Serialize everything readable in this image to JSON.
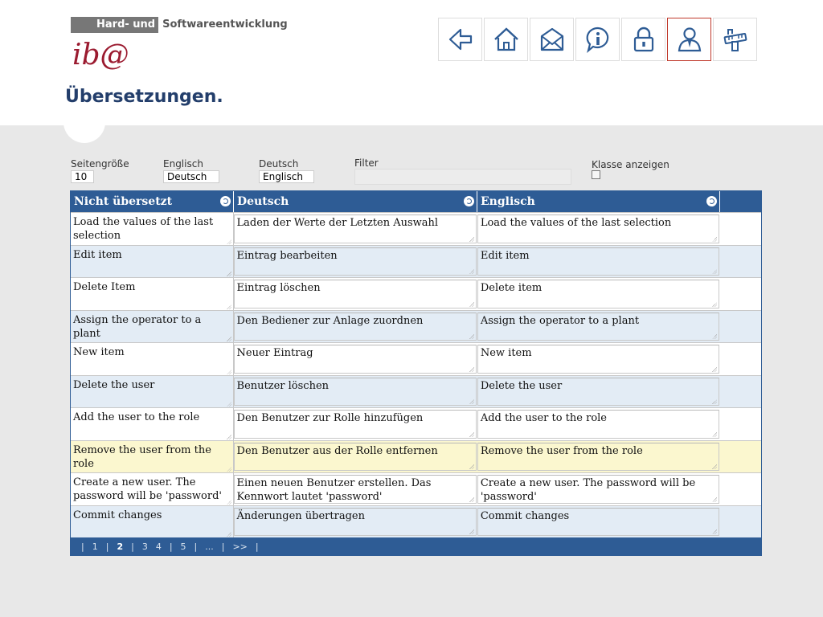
{
  "header": {
    "tag_dark": "Hard- und",
    "tag_light": "Softwareentwicklung",
    "logo_text": "ib@",
    "page_title": "Übersetzungen.",
    "accent_color": "#2e5c95",
    "logo_color": "#9b1b30"
  },
  "nav": [
    {
      "icon": "back-arrow-icon",
      "active": false
    },
    {
      "icon": "home-icon",
      "active": false
    },
    {
      "icon": "envelope-icon",
      "active": false
    },
    {
      "icon": "info-icon",
      "active": false
    },
    {
      "icon": "lock-icon",
      "active": false
    },
    {
      "icon": "user-icon",
      "active": true
    },
    {
      "icon": "tools-icon",
      "active": false
    }
  ],
  "filters": {
    "page_size_label": "Seitengröße",
    "page_size_value": "10",
    "english_label": "Englisch",
    "english_value": "Deutsch",
    "german_label": "Deutsch",
    "german_value": "Englisch",
    "filter_label": "Filter",
    "filter_value": "",
    "show_class_label": "Klasse anzeigen",
    "show_class_checked": false
  },
  "table": {
    "columns": [
      "Nicht übersetzt",
      "Deutsch",
      "Englisch",
      ""
    ],
    "rows": [
      [
        "Load the values of the last selection",
        "Laden der Werte der Letzten Auswahl",
        "Load the values of the last selection"
      ],
      [
        "Edit item",
        "Eintrag bearbeiten",
        "Edit item"
      ],
      [
        "Delete Item",
        "Eintrag löschen",
        "Delete item"
      ],
      [
        "Assign the operator to a plant",
        "Den Bediener zur Anlage zuordnen",
        "Assign the operator to a plant"
      ],
      [
        "New item",
        "Neuer Eintrag",
        "New item"
      ],
      [
        "Delete the user",
        "Benutzer löschen",
        "Delete the user"
      ],
      [
        "Add the user to the role",
        "Den Benutzer zur Rolle hinzufügen",
        "Add the user to the role"
      ],
      [
        "Remove the user from the role",
        "Den Benutzer aus der Rolle entfernen",
        "Remove the user from the role"
      ],
      [
        "Create a new user. The password will be 'password'",
        "Einen neuen Benutzer erstellen. Das Kennwort lautet 'password'",
        "Create a new user. The password will be 'password'"
      ],
      [
        "Commit changes",
        "Änderungen übertragen",
        "Commit changes"
      ]
    ],
    "highlighted_row": 7
  },
  "pager": {
    "items": [
      "|",
      "1",
      "|",
      "2",
      "|",
      "3",
      "4",
      "|",
      "5",
      "|",
      "...",
      "|",
      ">>",
      "|"
    ],
    "current": "2"
  }
}
